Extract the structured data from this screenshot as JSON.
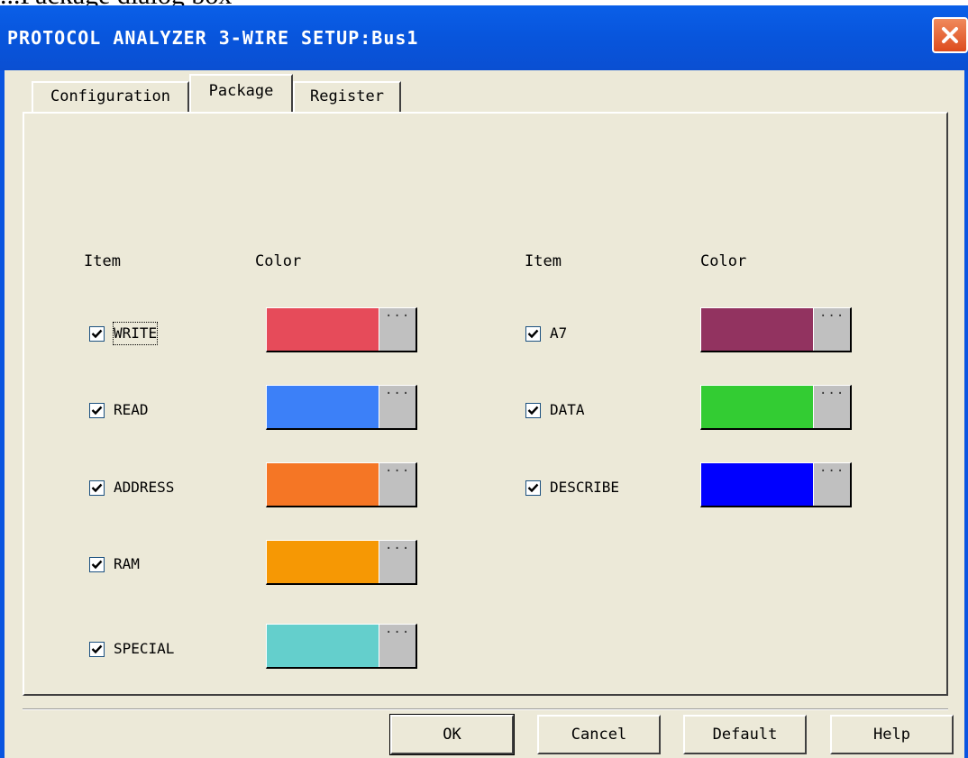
{
  "top_caption": "...Package dialog box",
  "window": {
    "title": "PROTOCOL ANALYZER 3-WIRE SETUP:Bus1"
  },
  "tabs": [
    {
      "label": "Configuration",
      "selected": false
    },
    {
      "label": "Package",
      "selected": true
    },
    {
      "label": "Register",
      "selected": false
    }
  ],
  "columns": {
    "left_item_header": "Item",
    "left_color_header": "Color",
    "right_item_header": "Item",
    "right_color_header": "Color"
  },
  "items": [
    {
      "label": "WRITE",
      "checked": true,
      "color": "#e64b5a"
    },
    {
      "label": "READ",
      "checked": true,
      "color": "#3c80f8"
    },
    {
      "label": "ADDRESS",
      "checked": true,
      "color": "#f57625"
    },
    {
      "label": "RAM",
      "checked": true,
      "color": "#f69804"
    },
    {
      "label": "SPECIAL",
      "checked": true,
      "color": "#64cfcc"
    },
    {
      "label": "A7",
      "checked": true,
      "color": "#923360"
    },
    {
      "label": "DATA",
      "checked": true,
      "color": "#33cc33"
    },
    {
      "label": "DESCRIBE",
      "checked": true,
      "color": "#0000ff"
    }
  ],
  "buttons": {
    "ok": "OK",
    "cancel": "Cancel",
    "default": "Default",
    "help": "Help"
  },
  "icons": {
    "close": "close-icon",
    "check": "checkmark-icon",
    "browse": "ellipsis-icon"
  }
}
